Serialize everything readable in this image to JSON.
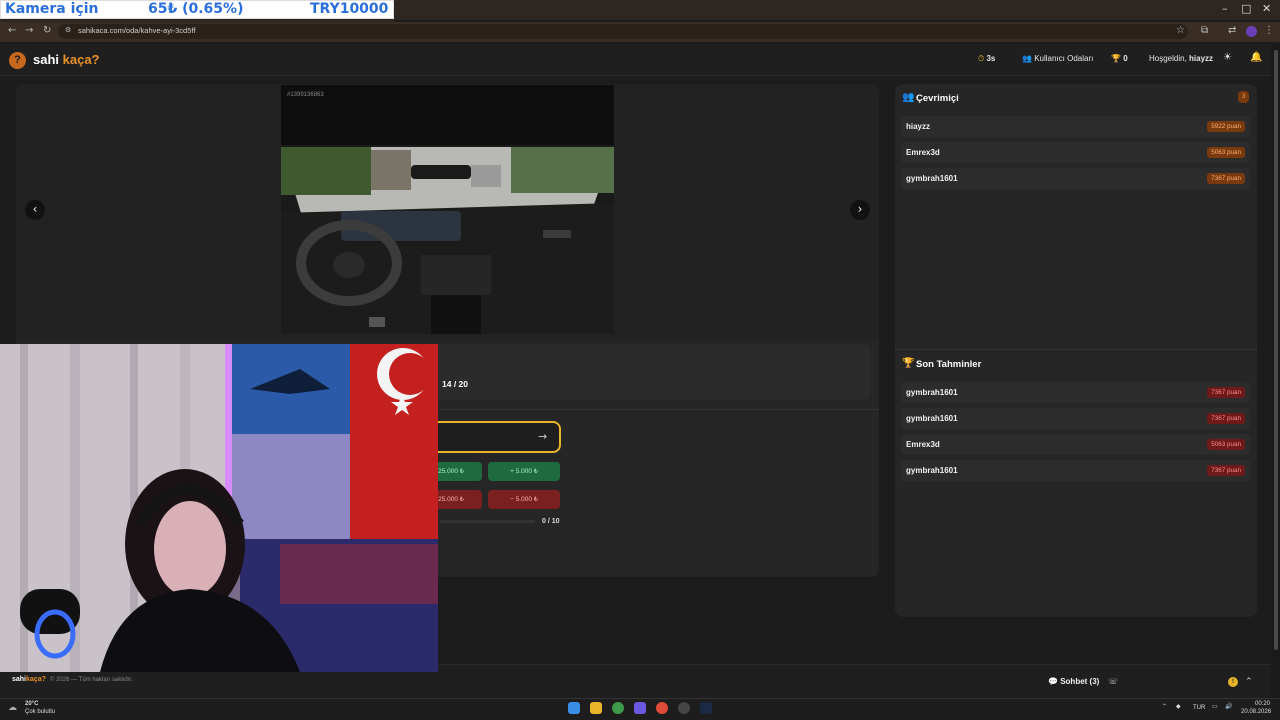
{
  "overlay": {
    "label": "Kamera için",
    "amount": "65₺ (0.65%)",
    "target": "TRY10000"
  },
  "browser": {
    "url": "sahikaca.com/oda/kahve-ayi-3cd5ff",
    "controls": {
      "minimize": "–",
      "maximize": "□",
      "close": "✕"
    }
  },
  "header": {
    "logo_main": "sahi",
    "logo_accent": "kaça?",
    "timer": "3s",
    "rooms_label": "Kullanıcı Odaları",
    "trophy_count": "0",
    "welcome": "Hoşgeldin,",
    "username": "hiayzz"
  },
  "game": {
    "photo_id": "#1399136863",
    "round": "14 / 20",
    "guess_count": "0 / 10",
    "adjust_buttons": [
      {
        "label": "25.000 ₺",
        "kind": "plus"
      },
      {
        "label": "+ 5.000 ₺",
        "kind": "plus"
      },
      {
        "label": "25.000 ₺",
        "kind": "minus"
      },
      {
        "label": "− 5.000 ₺",
        "kind": "minus"
      }
    ]
  },
  "online": {
    "title": "Çevrimiçi",
    "count": "3",
    "users": [
      {
        "name": "hiayzz",
        "score": "5922 puan"
      },
      {
        "name": "Emrex3d",
        "score": "5063 puan"
      },
      {
        "name": "gymbrah1601",
        "score": "7367 puan"
      }
    ]
  },
  "recent": {
    "title": "Son Tahminler",
    "entries": [
      {
        "name": "gymbrah1601",
        "score": "7367 puan"
      },
      {
        "name": "gymbrah1601",
        "score": "7367 puan"
      },
      {
        "name": "Emrex3d",
        "score": "5063 puan"
      },
      {
        "name": "gymbrah1601",
        "score": "7367 puan"
      }
    ]
  },
  "footer": {
    "logo_main": "sahi",
    "logo_accent": "kaça?",
    "copyright": "© 2026 — Tüm hakları saklıdır.",
    "chat_label": "Sohbet (3)",
    "badge": "!"
  },
  "taskbar": {
    "temperature": "20°C",
    "weather": "Çok bulutlu",
    "language": "TUR",
    "time": "00:20",
    "date": "20.08.2026"
  },
  "colors": {
    "accent": "#e8922a",
    "highlight": "#e8b42a",
    "plus": "#1f6b3f",
    "minus": "#7a2020"
  }
}
